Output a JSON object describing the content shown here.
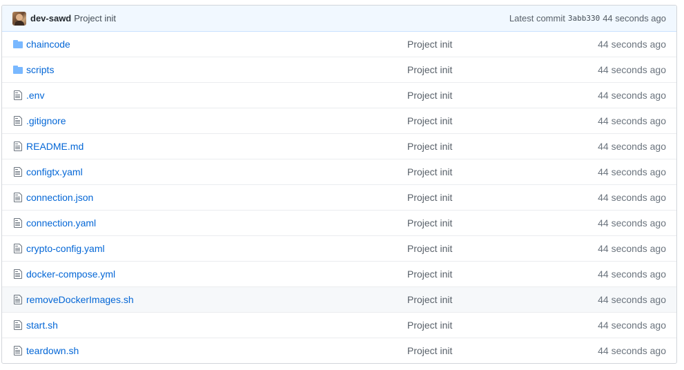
{
  "commit": {
    "author": "dev-sawd",
    "message": "Project init",
    "latest_label": "Latest commit",
    "sha": "3abb330",
    "age": "44 seconds ago"
  },
  "colors": {
    "link": "#0366d6",
    "folder_icon": "#79b8ff",
    "file_icon": "#6a737d",
    "header_bg": "#f1f8ff"
  },
  "files": [
    {
      "name": "chaincode",
      "type": "directory",
      "icon": "folder-icon",
      "message": "Project init",
      "age": "44 seconds ago"
    },
    {
      "name": "scripts",
      "type": "directory",
      "icon": "folder-icon",
      "message": "Project init",
      "age": "44 seconds ago"
    },
    {
      "name": ".env",
      "type": "file",
      "icon": "file-icon",
      "message": "Project init",
      "age": "44 seconds ago"
    },
    {
      "name": ".gitignore",
      "type": "file",
      "icon": "file-icon",
      "message": "Project init",
      "age": "44 seconds ago"
    },
    {
      "name": "README.md",
      "type": "file",
      "icon": "file-icon",
      "message": "Project init",
      "age": "44 seconds ago"
    },
    {
      "name": "configtx.yaml",
      "type": "file",
      "icon": "file-icon",
      "message": "Project init",
      "age": "44 seconds ago"
    },
    {
      "name": "connection.json",
      "type": "file",
      "icon": "file-icon",
      "message": "Project init",
      "age": "44 seconds ago"
    },
    {
      "name": "connection.yaml",
      "type": "file",
      "icon": "file-icon",
      "message": "Project init",
      "age": "44 seconds ago"
    },
    {
      "name": "crypto-config.yaml",
      "type": "file",
      "icon": "file-icon",
      "message": "Project init",
      "age": "44 seconds ago"
    },
    {
      "name": "docker-compose.yml",
      "type": "file",
      "icon": "file-icon",
      "message": "Project init",
      "age": "44 seconds ago"
    },
    {
      "name": "removeDockerImages.sh",
      "type": "file",
      "icon": "file-icon",
      "message": "Project init",
      "age": "44 seconds ago",
      "hovered": true
    },
    {
      "name": "start.sh",
      "type": "file",
      "icon": "file-icon",
      "message": "Project init",
      "age": "44 seconds ago"
    },
    {
      "name": "teardown.sh",
      "type": "file",
      "icon": "file-icon",
      "message": "Project init",
      "age": "44 seconds ago"
    }
  ]
}
